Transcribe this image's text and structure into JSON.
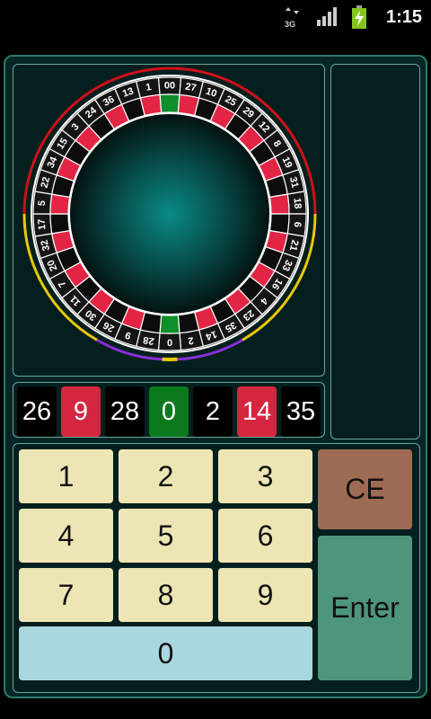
{
  "status_bar": {
    "time": "1:15",
    "network_label": "3G",
    "icons": [
      "network-3g-icon",
      "signal-icon",
      "battery-charging-icon"
    ]
  },
  "wheel": {
    "pockets": [
      "00",
      "27",
      "10",
      "25",
      "29",
      "12",
      "8",
      "19",
      "31",
      "18",
      "6",
      "21",
      "33",
      "16",
      "4",
      "23",
      "35",
      "14",
      "2",
      "0",
      "28",
      "9",
      "26",
      "30",
      "11",
      "7",
      "20",
      "32",
      "17",
      "5",
      "22",
      "34",
      "15",
      "3",
      "24",
      "36",
      "13",
      "1"
    ],
    "red_numbers": [
      1,
      3,
      5,
      7,
      9,
      12,
      14,
      16,
      18,
      19,
      21,
      23,
      25,
      27,
      30,
      32,
      34,
      36
    ],
    "colors": {
      "red": "#e22544",
      "black": "#0c0c0c",
      "green": "#0f8f2b",
      "track_red": "#d0101a",
      "track_yellow": "#e8c80a",
      "track_purple": "#8a2fd8"
    }
  },
  "history": {
    "numbers": [
      {
        "value": "26",
        "color": "#000000"
      },
      {
        "value": "9",
        "color": "#d5263f"
      },
      {
        "value": "28",
        "color": "#000000"
      },
      {
        "value": "0",
        "color": "#0b7a1c"
      },
      {
        "value": "2",
        "color": "#000000"
      },
      {
        "value": "14",
        "color": "#d5263f"
      },
      {
        "value": "35",
        "color": "#000000"
      }
    ]
  },
  "keypad": {
    "keys": [
      "1",
      "2",
      "3",
      "4",
      "5",
      "6",
      "7",
      "8",
      "9"
    ],
    "zero": "0",
    "ce": "CE",
    "enter": "Enter"
  }
}
